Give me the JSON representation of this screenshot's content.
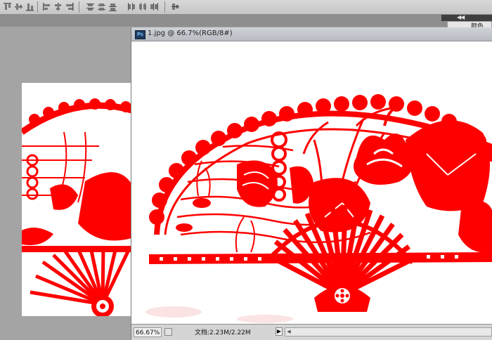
{
  "document": {
    "title": "1.jpg @ 66.7%(RGB/8#)",
    "app_icon_text": "Ps"
  },
  "status": {
    "zoom": "66.67%",
    "doc_info": "文档:2.23M/2.22M",
    "menu_arrow": "▶"
  },
  "panel": {
    "tab_label": "颜色",
    "collapse_label": "◀◀"
  },
  "toolbar_icons": [
    "align-top-edges-icon",
    "align-vertical-centers-icon",
    "align-bottom-edges-icon",
    "align-left-edges-icon",
    "align-horizontal-centers-icon",
    "align-right-edges-icon",
    "distribute-top-icon",
    "distribute-vcenter-icon",
    "distribute-bottom-icon",
    "distribute-left-icon",
    "distribute-hcenter-icon",
    "distribute-right-icon",
    "auto-align-icon"
  ],
  "image_accent_color": "#ff0000"
}
